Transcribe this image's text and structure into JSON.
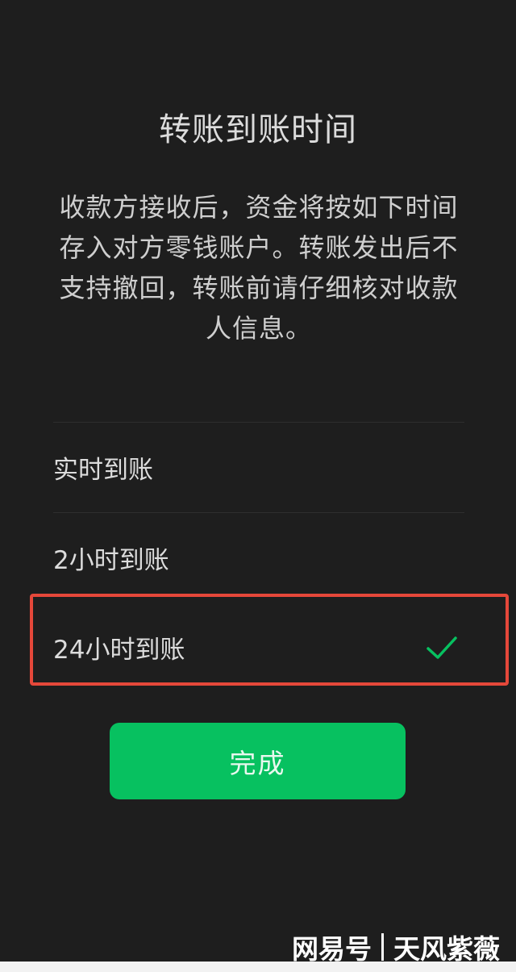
{
  "dialog": {
    "title": "转账到账时间",
    "description": "收款方接收后，资金将按如下时间存入对方零钱账户。转账发出后不支持撤回，转账前请仔细核对收款人信息。"
  },
  "options": [
    {
      "label": "实时到账",
      "selected": false
    },
    {
      "label": "2小时到账",
      "selected": false
    },
    {
      "label": "24小时到账",
      "selected": true
    }
  ],
  "done_button": {
    "label": "完成"
  },
  "watermark": {
    "platform": "网易号",
    "author": "天风紫薇"
  },
  "colors": {
    "accent": "#07c160",
    "highlight": "#e5483a",
    "background": "#1e1e1e"
  },
  "icons": {
    "selected": "check-icon"
  }
}
